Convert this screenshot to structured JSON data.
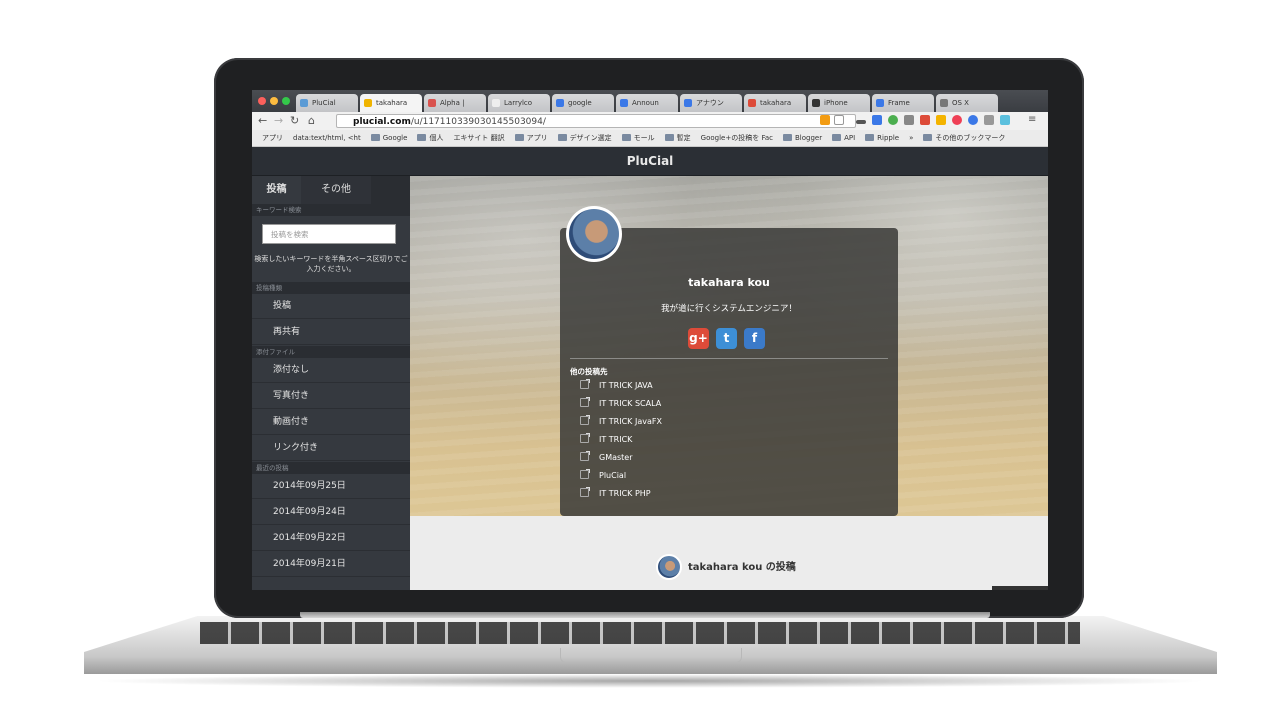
{
  "browser": {
    "tabs": [
      {
        "title": "PluCial",
        "color": "#5b9bd5"
      },
      {
        "title": "takahara",
        "color": "#f0b400",
        "active": true
      },
      {
        "title": "Alpha |",
        "color": "#d9534f"
      },
      {
        "title": "Larrylco",
        "color": "#eeeeee"
      },
      {
        "title": "google",
        "color": "#3b78e7"
      },
      {
        "title": "Announ",
        "color": "#3b78e7"
      },
      {
        "title": "アナウン",
        "color": "#3b78e7"
      },
      {
        "title": "takahara",
        "color": "#dd4b39"
      },
      {
        "title": "iPhone",
        "color": "#333333"
      },
      {
        "title": "Frame",
        "color": "#3b78e7"
      },
      {
        "title": "OS X",
        "color": "#777777"
      }
    ],
    "url_host": "plucial.com",
    "url_path": "/u/117110339030145503094/",
    "bookmarks": [
      {
        "label": "アプリ",
        "folder": false
      },
      {
        "label": "data:text/html, <ht",
        "folder": false
      },
      {
        "label": "Google",
        "folder": true
      },
      {
        "label": "個人",
        "folder": true
      },
      {
        "label": "エキサイト 翻訳",
        "folder": false
      },
      {
        "label": "アプリ",
        "folder": true
      },
      {
        "label": "デザイン選定",
        "folder": true
      },
      {
        "label": "モール",
        "folder": true
      },
      {
        "label": "暫定",
        "folder": true
      },
      {
        "label": "Google+の投稿を Fac",
        "folder": false
      },
      {
        "label": "Blogger",
        "folder": true
      },
      {
        "label": "API",
        "folder": true
      },
      {
        "label": "Ripple",
        "folder": true
      },
      {
        "label": "»",
        "folder": false
      },
      {
        "label": "その他のブックマーク",
        "folder": true
      }
    ]
  },
  "app": {
    "title": "PluCial"
  },
  "sidebar": {
    "tab_posts": "投稿",
    "tab_other": "その他",
    "keyword_section": "キーワード検索",
    "search_placeholder": "投稿を検索",
    "search_hint": "検索したいキーワードを半角スペース区切りでご入力ください。",
    "post_type_section": "投稿種類",
    "post_types": [
      "投稿",
      "再共有"
    ],
    "attachment_section": "添付ファイル",
    "attachments": [
      "添付なし",
      "写真付き",
      "動画付き",
      "リンク付き"
    ],
    "recent_section": "最近の投稿",
    "recent_dates": [
      "2014年09月25日",
      "2014年09月24日",
      "2014年09月22日",
      "2014年09月21日"
    ]
  },
  "profile": {
    "name": "takahara kou",
    "bio": "我が道に行くシステムエンジニア！",
    "social": [
      {
        "label": "g+",
        "icon": "google-plus-icon",
        "color": "#dd4b39"
      },
      {
        "label": "t",
        "icon": "tumblr-icon",
        "color": "#3d8fd6"
      },
      {
        "label": "f",
        "icon": "facebook-icon",
        "color": "#3b7ac9"
      }
    ],
    "other_sites_title": "他の投稿先",
    "other_sites": [
      "IT TRICK JAVA",
      "IT TRICK SCALA",
      "IT TRICK JavaFX",
      "IT TRICK",
      "GMaster",
      "PluCial",
      "IT TRICK PHP"
    ]
  },
  "posts": {
    "heading": "takahara kou の投稿"
  }
}
